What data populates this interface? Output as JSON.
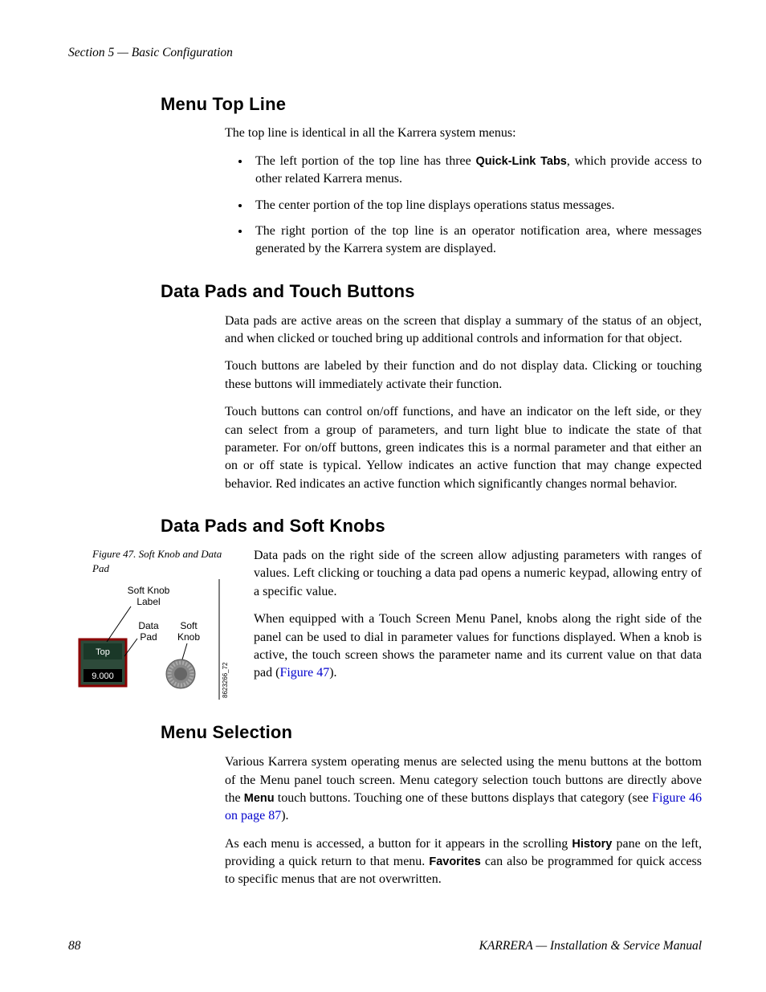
{
  "header": {
    "section_label": "Section 5 — Basic Configuration"
  },
  "sections": {
    "menu_top_line": {
      "heading": "Menu Top Line",
      "intro": "The top line is identical in all the Karrera system menus:",
      "bullets": {
        "b1_pre": "The left portion of the top line has three ",
        "b1_bold": "Quick-Link Tabs",
        "b1_post": ", which provide access to other related Karrera menus.",
        "b2": "The center portion of the top line displays operations status messages.",
        "b3": "The right portion of the top line is an operator notification area, where messages generated by the Karrera system are displayed."
      }
    },
    "data_pads_touch": {
      "heading": "Data Pads and Touch Buttons",
      "p1": "Data pads are active areas on the screen that display a summary of the status of an object, and when clicked or touched bring up additional controls and information for that object.",
      "p2": "Touch buttons are labeled by their function and do not display data. Clicking or touching these buttons will immediately activate their function.",
      "p3": "Touch buttons can control on/off functions, and have an indicator on the left side, or they can select from a group of parameters, and turn light blue to indicate the state of that parameter. For on/off buttons, green indicates this is a normal parameter and that either an on or off state is typical. Yellow indicates an active function that may change expected behavior. Red indicates an active function which significantly changes normal behavior."
    },
    "data_pads_soft_knobs": {
      "heading": "Data Pads and Soft Knobs",
      "fig_caption": "Figure 47.  Soft Knob and Data Pad",
      "fig_labels": {
        "soft_knob_label": "Soft Knob\nLabel",
        "data_pad": "Data\nPad",
        "soft_knob": "Soft\nKnob",
        "top": "Top",
        "value": "9.000",
        "side_code": "8623266_72"
      },
      "p1": "Data pads on the right side of the screen allow adjusting parameters with ranges of values. Left clicking or touching a data pad opens a numeric keypad, allowing entry of a specific value.",
      "p2_pre": "When equipped with a Touch Screen Menu Panel, knobs along the right side of the panel can be used to dial in parameter values for functions displayed. When a knob is active, the touch screen shows the parameter name and its current value on that data pad (",
      "p2_link": "Figure 47",
      "p2_post": ")."
    },
    "menu_selection": {
      "heading": "Menu Selection",
      "p1_pre": "Various Karrera system operating menus are selected using the menu buttons at the bottom of the Menu panel touch screen. Menu category selection touch buttons are directly above the ",
      "p1_bold": "Menu",
      "p1_mid": " touch buttons. Touching one of these buttons displays that category (see ",
      "p1_link": "Figure 46 on page 87",
      "p1_post": ").",
      "p2_pre": "As each menu is accessed, a button for it appears in the scrolling ",
      "p2_bold1": "History",
      "p2_mid": " pane on the left, providing a quick return to that menu. ",
      "p2_bold2": "Favorites",
      "p2_post": " can also be programmed for quick access to specific menus that are not overwritten."
    }
  },
  "footer": {
    "page_num": "88",
    "brand": "KARRERA",
    "sep": " — ",
    "title": "Installation & Service Manual"
  }
}
